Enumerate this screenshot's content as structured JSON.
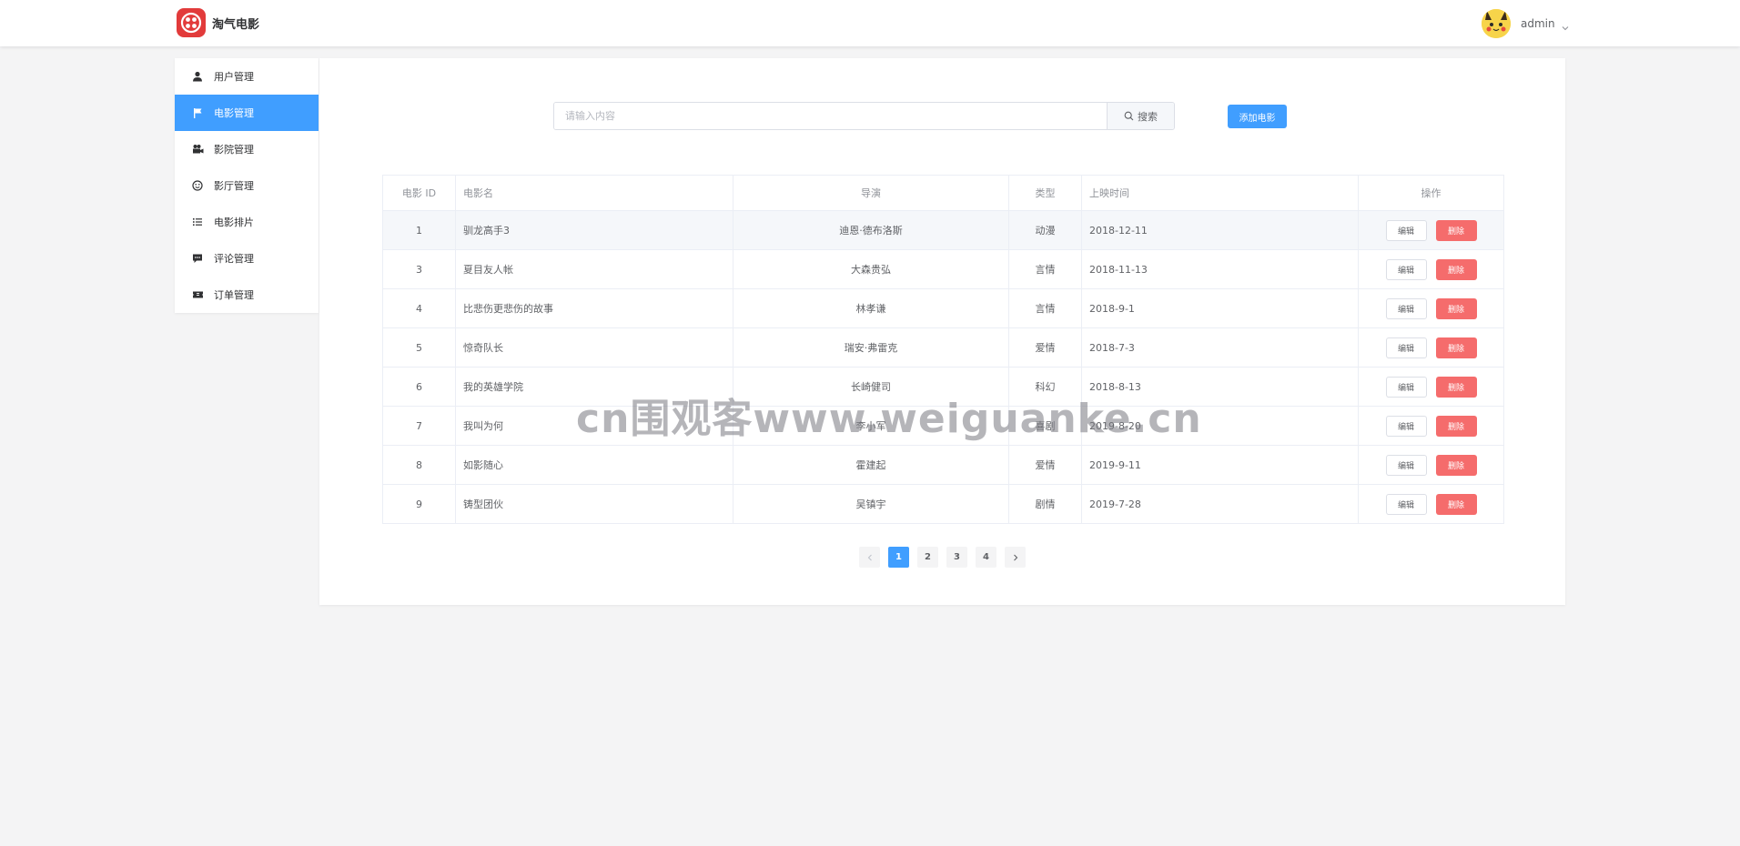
{
  "header": {
    "app_title": "淘气电影",
    "username": "admin",
    "logo_icon": "logo-icon",
    "avatar_icon": "pikachu-avatar-icon"
  },
  "sidebar": {
    "items": [
      {
        "label": "用户管理",
        "icon": "user-icon",
        "active": false
      },
      {
        "label": "电影管理",
        "icon": "flag-icon",
        "active": true
      },
      {
        "label": "影院管理",
        "icon": "camera-icon",
        "active": false
      },
      {
        "label": "影厅管理",
        "icon": "face-icon",
        "active": false
      },
      {
        "label": "电影排片",
        "icon": "list-icon",
        "active": false
      },
      {
        "label": "评论管理",
        "icon": "comment-icon",
        "active": false
      },
      {
        "label": "订单管理",
        "icon": "ticket-icon",
        "active": false
      }
    ]
  },
  "toolbar": {
    "search_placeholder": "请输入内容",
    "search_label": "搜索",
    "add_label": "添加电影"
  },
  "table": {
    "headers": {
      "id": "电影 ID",
      "name": "电影名",
      "director": "导演",
      "type": "类型",
      "release": "上映时间",
      "actions": "操作"
    },
    "edit_label": "编辑",
    "delete_label": "删除",
    "rows": [
      {
        "id": "1",
        "name": "驯龙高手3",
        "director": "迪恩·德布洛斯",
        "type": "动漫",
        "release": "2018-12-11"
      },
      {
        "id": "3",
        "name": "夏目友人帐",
        "director": "大森贵弘",
        "type": "言情",
        "release": "2018-11-13"
      },
      {
        "id": "4",
        "name": "比悲伤更悲伤的故事",
        "director": "林孝谦",
        "type": "言情",
        "release": "2018-9-1"
      },
      {
        "id": "5",
        "name": "惊奇队长",
        "director": "瑞安·弗雷克",
        "type": "爱情",
        "release": "2018-7-3"
      },
      {
        "id": "6",
        "name": "我的英雄学院",
        "director": "长崎健司",
        "type": "科幻",
        "release": "2018-8-13"
      },
      {
        "id": "7",
        "name": "我叫为何",
        "director": "李小军",
        "type": "喜剧",
        "release": "2019-8-20"
      },
      {
        "id": "8",
        "name": "如影随心",
        "director": "霍建起",
        "type": "爱情",
        "release": "2019-9-11"
      },
      {
        "id": "9",
        "name": "铸型团伙",
        "director": "吴镇宇",
        "type": "剧情",
        "release": "2019-7-28"
      }
    ]
  },
  "pagination": {
    "pages": [
      "1",
      "2",
      "3",
      "4"
    ],
    "current": "1"
  },
  "watermark": "cn围观客www.weiguanke.cn",
  "colors": {
    "primary": "#409eff",
    "danger": "#f56c6c",
    "logo": "#e23b3b",
    "background": "#f4f4f5"
  }
}
